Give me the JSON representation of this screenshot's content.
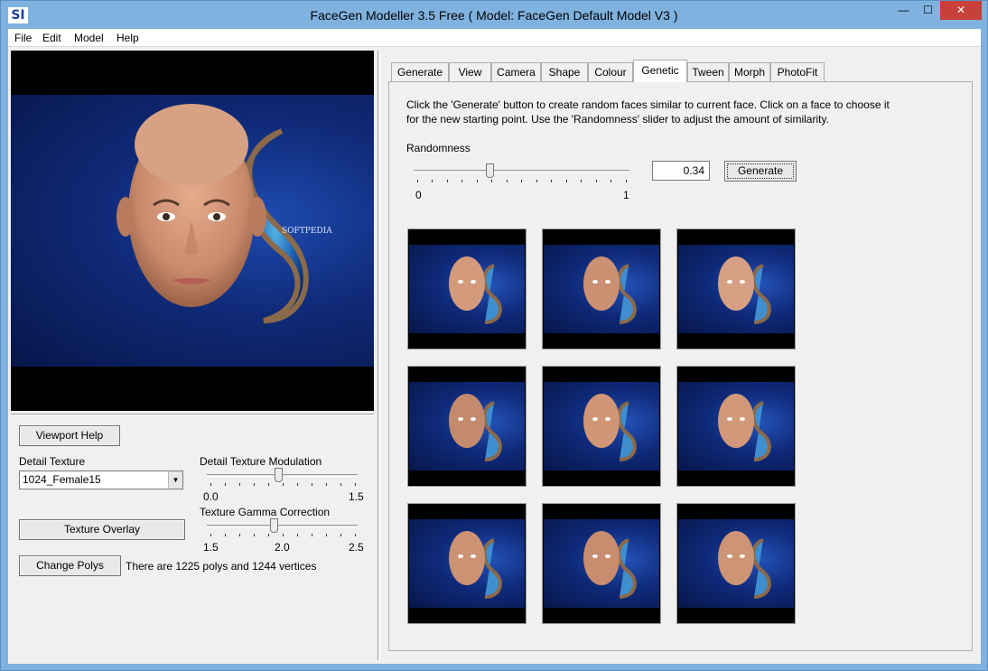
{
  "window": {
    "title": "FaceGen Modeller 3.5 Free  ( Model: FaceGen Default Model V3 )",
    "icon_label": "SI",
    "controls": {
      "minimize": "—",
      "maximize": "☐",
      "close": "✕"
    }
  },
  "menu": [
    "File",
    "Edit",
    "Model",
    "Help"
  ],
  "viewport": {
    "watermark": "SOFTPEDIA",
    "watermark_url": "www.softpedia.com"
  },
  "left_panel": {
    "viewport_help": "Viewport Help",
    "detail_texture_label": "Detail Texture",
    "detail_texture_value": "1024_Female15",
    "modulation": {
      "label": "Detail Texture Modulation",
      "min": "0.0",
      "max": "1.5",
      "value": 0.5
    },
    "gamma": {
      "label": "Texture Gamma Correction",
      "min": "1.5",
      "mid": "2.0",
      "max": "2.5",
      "value": 2.0
    },
    "texture_overlay": "Texture Overlay",
    "change_polys": "Change Polys",
    "poly_info": "There are 1225 polys and 1244 vertices"
  },
  "tabs": [
    "Generate",
    "View",
    "Camera",
    "Shape",
    "Colour",
    "Genetic",
    "Tween",
    "Morph",
    "PhotoFit"
  ],
  "active_tab": "Genetic",
  "genetic": {
    "instructions_line1": "Click the 'Generate' button to create random faces similar to current face.  Click on a face to choose it",
    "instructions_line2": "for the new starting point.  Use the 'Randomness' slider to adjust the amount of similarity.",
    "randomness_label": "Randomness",
    "randomness_value": "0.34",
    "slider_min": "0",
    "slider_max": "1",
    "generate_button": "Generate",
    "face_count": 9
  }
}
